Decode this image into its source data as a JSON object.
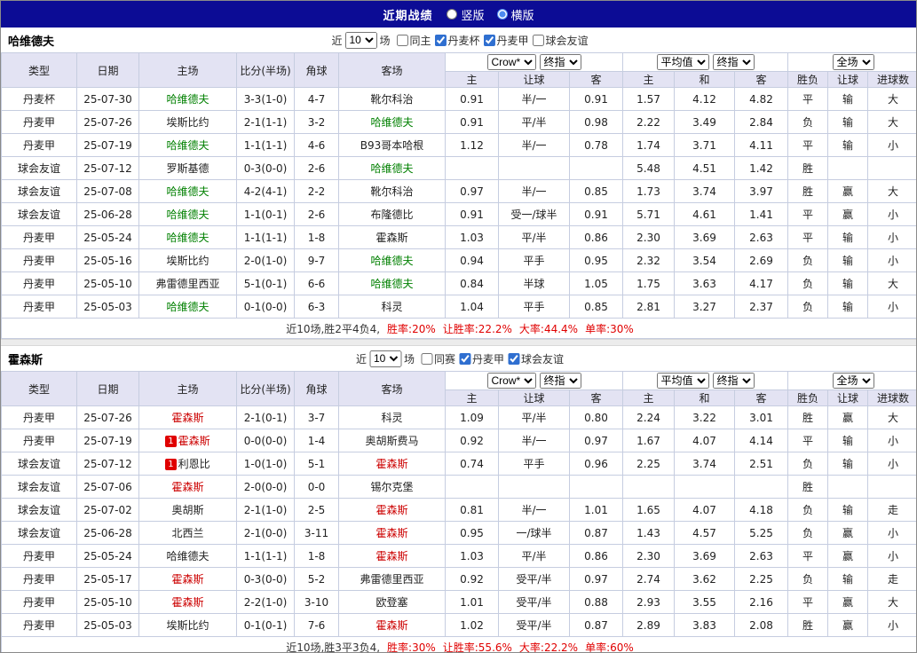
{
  "topbar": {
    "title": "近期战绩",
    "radios": [
      {
        "label": "竖版",
        "selected": false
      },
      {
        "label": "横版",
        "selected": true
      }
    ]
  },
  "header": {
    "columns": [
      "类型",
      "日期",
      "主场",
      "比分(半场)",
      "角球",
      "客场"
    ],
    "odds_selects": [
      "Crow*",
      "终指"
    ],
    "odds_cols": [
      "主",
      "让球",
      "客"
    ],
    "avg_selects": [
      "平均值",
      "终指"
    ],
    "avg_cols": [
      "主",
      "和",
      "客"
    ],
    "full_selects": [
      "全场"
    ],
    "full_cols": [
      "胜负",
      "让球",
      "进球数"
    ]
  },
  "colors": {
    "league_purple": "#7b7ae1",
    "league_teal": "#2eb1a4",
    "win_red": "#cc0000",
    "draw_green": "#008000",
    "loss_blue": "#0014cc",
    "score_red": "#cc0000",
    "topbar_navy": "#0c0c95",
    "header_lavender": "#e3e3f3"
  },
  "tables": [
    {
      "team": "哈维德夫",
      "filter": {
        "pre": "近",
        "count": "10",
        "post": "场",
        "checks": [
          {
            "label": "同主",
            "checked": false
          },
          {
            "label": "丹麦杯",
            "checked": true
          },
          {
            "label": "丹麦甲",
            "checked": true
          },
          {
            "label": "球会友谊",
            "checked": false
          }
        ]
      },
      "rows": [
        {
          "league": "丹麦杯",
          "lt": "purple",
          "date": "25-07-30",
          "home": {
            "t": "哈维德夫",
            "c": "g"
          },
          "score": "3-3(1-0)",
          "corner": "4-7",
          "away": {
            "t": "靴尔科治",
            "c": "k"
          },
          "odds": [
            "0.91",
            "半/一",
            "0.91"
          ],
          "avg": [
            "1.57",
            "4.12",
            "4.82"
          ],
          "res": [
            "平",
            "g"
          ],
          "let": [
            "输",
            "b"
          ],
          "goal": [
            "大",
            "r"
          ]
        },
        {
          "league": "丹麦甲",
          "lt": "purple",
          "date": "25-07-26",
          "home": {
            "t": "埃斯比约",
            "c": "k"
          },
          "score": "2-1(1-1)",
          "corner": "3-2",
          "away": {
            "t": "哈维德夫",
            "c": "g"
          },
          "odds": [
            "0.91",
            "平/半",
            "0.98"
          ],
          "avg": [
            "2.22",
            "3.49",
            "2.84"
          ],
          "res": [
            "负",
            "b"
          ],
          "let": [
            "输",
            "b"
          ],
          "goal": [
            "大",
            "r"
          ]
        },
        {
          "league": "丹麦甲",
          "lt": "purple",
          "date": "25-07-19",
          "home": {
            "t": "哈维德夫",
            "c": "g"
          },
          "score": "1-1(1-1)",
          "corner": "4-6",
          "away": {
            "t": "B93哥本哈根",
            "c": "k"
          },
          "odds": [
            "1.12",
            "半/一",
            "0.78"
          ],
          "avg": [
            "1.74",
            "3.71",
            "4.11"
          ],
          "res": [
            "平",
            "g"
          ],
          "let": [
            "输",
            "b"
          ],
          "goal": [
            "小",
            "b"
          ]
        },
        {
          "league": "球会友谊",
          "lt": "teal",
          "date": "25-07-12",
          "home": {
            "t": "罗斯基德",
            "c": "k"
          },
          "score": "0-3(0-0)",
          "corner": "2-6",
          "away": {
            "t": "哈维德夫",
            "c": "g"
          },
          "odds": [
            "",
            "",
            ""
          ],
          "avg": [
            "5.48",
            "4.51",
            "1.42"
          ],
          "res": [
            "胜",
            "r"
          ],
          "let": [
            "",
            ""
          ],
          "goal": [
            "",
            ""
          ]
        },
        {
          "league": "球会友谊",
          "lt": "teal",
          "date": "25-07-08",
          "home": {
            "t": "哈维德夫",
            "c": "g"
          },
          "score": "4-2(4-1)",
          "corner": "2-2",
          "away": {
            "t": "靴尔科治",
            "c": "k"
          },
          "odds": [
            "0.97",
            "半/一",
            "0.85"
          ],
          "avg": [
            "1.73",
            "3.74",
            "3.97"
          ],
          "res": [
            "胜",
            "r"
          ],
          "let": [
            "赢",
            "r"
          ],
          "goal": [
            "大",
            "r"
          ]
        },
        {
          "league": "球会友谊",
          "lt": "teal",
          "date": "25-06-28",
          "home": {
            "t": "哈维德夫",
            "c": "g"
          },
          "score": "1-1(0-1)",
          "corner": "2-6",
          "away": {
            "t": "布隆德比",
            "c": "k"
          },
          "odds": [
            "0.91",
            "受一/球半",
            "0.91"
          ],
          "avg": [
            "5.71",
            "4.61",
            "1.41"
          ],
          "res": [
            "平",
            "g"
          ],
          "let": [
            "赢",
            "r"
          ],
          "goal": [
            "小",
            "b"
          ]
        },
        {
          "league": "丹麦甲",
          "lt": "purple",
          "date": "25-05-24",
          "home": {
            "t": "哈维德夫",
            "c": "g"
          },
          "score": "1-1(1-1)",
          "corner": "1-8",
          "away": {
            "t": "霍森斯",
            "c": "k"
          },
          "odds": [
            "1.03",
            "平/半",
            "0.86"
          ],
          "avg": [
            "2.30",
            "3.69",
            "2.63"
          ],
          "res": [
            "平",
            "g"
          ],
          "let": [
            "输",
            "b"
          ],
          "goal": [
            "小",
            "b"
          ]
        },
        {
          "league": "丹麦甲",
          "lt": "purple",
          "date": "25-05-16",
          "home": {
            "t": "埃斯比约",
            "c": "k"
          },
          "score": "2-0(1-0)",
          "corner": "9-7",
          "away": {
            "t": "哈维德夫",
            "c": "g"
          },
          "odds": [
            "0.94",
            "平手",
            "0.95"
          ],
          "avg": [
            "2.32",
            "3.54",
            "2.69"
          ],
          "res": [
            "负",
            "b"
          ],
          "let": [
            "输",
            "b"
          ],
          "goal": [
            "小",
            "b"
          ]
        },
        {
          "league": "丹麦甲",
          "lt": "purple",
          "date": "25-05-10",
          "home": {
            "t": "弗雷德里西亚",
            "c": "k"
          },
          "score": "5-1(0-1)",
          "corner": "6-6",
          "away": {
            "t": "哈维德夫",
            "c": "g"
          },
          "odds": [
            "0.84",
            "半球",
            "1.05"
          ],
          "avg": [
            "1.75",
            "3.63",
            "4.17"
          ],
          "res": [
            "负",
            "b"
          ],
          "let": [
            "输",
            "b"
          ],
          "goal": [
            "大",
            "r"
          ]
        },
        {
          "league": "丹麦甲",
          "lt": "purple",
          "date": "25-05-03",
          "home": {
            "t": "哈维德夫",
            "c": "g"
          },
          "score": "0-1(0-0)",
          "corner": "6-3",
          "away": {
            "t": "科灵",
            "c": "k"
          },
          "odds": [
            "1.04",
            "平手",
            "0.85"
          ],
          "avg": [
            "2.81",
            "3.27",
            "2.37"
          ],
          "res": [
            "负",
            "b"
          ],
          "let": [
            "输",
            "b"
          ],
          "goal": [
            "小",
            "b"
          ]
        }
      ],
      "summary": {
        "prefix": "近10场,胜2平4负4,",
        "stats": [
          "胜率:20%",
          "让胜率:22.2%",
          "大率:44.4%",
          "单率:30%"
        ]
      }
    },
    {
      "team": "霍森斯",
      "filter": {
        "pre": "近",
        "count": "10",
        "post": "场",
        "checks": [
          {
            "label": "同赛",
            "checked": false
          },
          {
            "label": "丹麦甲",
            "checked": true
          },
          {
            "label": "球会友谊",
            "checked": true
          }
        ]
      },
      "rows": [
        {
          "league": "丹麦甲",
          "lt": "purple",
          "date": "25-07-26",
          "home": {
            "t": "霍森斯",
            "c": "r"
          },
          "score": "2-1(0-1)",
          "corner": "3-7",
          "away": {
            "t": "科灵",
            "c": "k"
          },
          "odds": [
            "1.09",
            "平/半",
            "0.80"
          ],
          "avg": [
            "2.24",
            "3.22",
            "3.01"
          ],
          "res": [
            "胜",
            "r"
          ],
          "let": [
            "赢",
            "r"
          ],
          "goal": [
            "大",
            "r"
          ]
        },
        {
          "league": "丹麦甲",
          "lt": "purple",
          "date": "25-07-19",
          "home": {
            "t": "霍森斯",
            "c": "r",
            "badge": "1"
          },
          "score": "0-0(0-0)",
          "corner": "1-4",
          "away": {
            "t": "奥胡斯费马",
            "c": "k"
          },
          "odds": [
            "0.92",
            "半/一",
            "0.97"
          ],
          "avg": [
            "1.67",
            "4.07",
            "4.14"
          ],
          "res": [
            "平",
            "g"
          ],
          "let": [
            "输",
            "b"
          ],
          "goal": [
            "小",
            "b"
          ]
        },
        {
          "league": "球会友谊",
          "lt": "teal",
          "date": "25-07-12",
          "home": {
            "t": "利恩比",
            "c": "k",
            "badge": "1"
          },
          "score": "1-0(1-0)",
          "corner": "5-1",
          "away": {
            "t": "霍森斯",
            "c": "r"
          },
          "odds": [
            "0.74",
            "平手",
            "0.96"
          ],
          "avg": [
            "2.25",
            "3.74",
            "2.51"
          ],
          "res": [
            "负",
            "b"
          ],
          "let": [
            "输",
            "b"
          ],
          "goal": [
            "小",
            "b"
          ]
        },
        {
          "league": "球会友谊",
          "lt": "teal",
          "date": "25-07-06",
          "home": {
            "t": "霍森斯",
            "c": "r"
          },
          "score": "2-0(0-0)",
          "corner": "0-0",
          "away": {
            "t": "锡尔克堡",
            "c": "k"
          },
          "odds": [
            "",
            "",
            ""
          ],
          "avg": [
            "",
            "",
            ""
          ],
          "res": [
            "胜",
            "r"
          ],
          "let": [
            "",
            ""
          ],
          "goal": [
            "",
            ""
          ]
        },
        {
          "league": "球会友谊",
          "lt": "teal",
          "date": "25-07-02",
          "home": {
            "t": "奥胡斯",
            "c": "k"
          },
          "score": "2-1(1-0)",
          "corner": "2-5",
          "away": {
            "t": "霍森斯",
            "c": "r"
          },
          "odds": [
            "0.81",
            "半/一",
            "1.01"
          ],
          "avg": [
            "1.65",
            "4.07",
            "4.18"
          ],
          "res": [
            "负",
            "b"
          ],
          "let": [
            "输",
            "b"
          ],
          "goal": [
            "走",
            "g"
          ]
        },
        {
          "league": "球会友谊",
          "lt": "teal",
          "date": "25-06-28",
          "home": {
            "t": "北西兰",
            "c": "k"
          },
          "score": "2-1(0-0)",
          "corner": "3-11",
          "away": {
            "t": "霍森斯",
            "c": "r"
          },
          "odds": [
            "0.95",
            "一/球半",
            "0.87"
          ],
          "avg": [
            "1.43",
            "4.57",
            "5.25"
          ],
          "res": [
            "负",
            "b"
          ],
          "let": [
            "赢",
            "r"
          ],
          "goal": [
            "小",
            "b"
          ]
        },
        {
          "league": "丹麦甲",
          "lt": "purple",
          "date": "25-05-24",
          "home": {
            "t": "哈维德夫",
            "c": "k"
          },
          "score": "1-1(1-1)",
          "corner": "1-8",
          "away": {
            "t": "霍森斯",
            "c": "r"
          },
          "odds": [
            "1.03",
            "平/半",
            "0.86"
          ],
          "avg": [
            "2.30",
            "3.69",
            "2.63"
          ],
          "res": [
            "平",
            "g"
          ],
          "let": [
            "赢",
            "r"
          ],
          "goal": [
            "小",
            "b"
          ]
        },
        {
          "league": "丹麦甲",
          "lt": "purple",
          "date": "25-05-17",
          "home": {
            "t": "霍森斯",
            "c": "r"
          },
          "score": "0-3(0-0)",
          "corner": "5-2",
          "away": {
            "t": "弗雷德里西亚",
            "c": "k"
          },
          "odds": [
            "0.92",
            "受平/半",
            "0.97"
          ],
          "avg": [
            "2.74",
            "3.62",
            "2.25"
          ],
          "res": [
            "负",
            "b"
          ],
          "let": [
            "输",
            "b"
          ],
          "goal": [
            "走",
            "g"
          ]
        },
        {
          "league": "丹麦甲",
          "lt": "purple",
          "date": "25-05-10",
          "home": {
            "t": "霍森斯",
            "c": "r"
          },
          "score": "2-2(1-0)",
          "corner": "3-10",
          "away": {
            "t": "欧登塞",
            "c": "k"
          },
          "odds": [
            "1.01",
            "受平/半",
            "0.88"
          ],
          "avg": [
            "2.93",
            "3.55",
            "2.16"
          ],
          "res": [
            "平",
            "g"
          ],
          "let": [
            "赢",
            "r"
          ],
          "goal": [
            "大",
            "r"
          ]
        },
        {
          "league": "丹麦甲",
          "lt": "purple",
          "date": "25-05-03",
          "home": {
            "t": "埃斯比约",
            "c": "k"
          },
          "score": "0-1(0-1)",
          "corner": "7-6",
          "away": {
            "t": "霍森斯",
            "c": "r"
          },
          "odds": [
            "1.02",
            "受平/半",
            "0.87"
          ],
          "avg": [
            "2.89",
            "3.83",
            "2.08"
          ],
          "res": [
            "胜",
            "r"
          ],
          "let": [
            "赢",
            "r"
          ],
          "goal": [
            "小",
            "b"
          ]
        }
      ],
      "summary": {
        "prefix": "近10场,胜3平3负4,",
        "stats": [
          "胜率:30%",
          "让胜率:55.6%",
          "大率:22.2%",
          "单率:60%"
        ]
      }
    }
  ]
}
